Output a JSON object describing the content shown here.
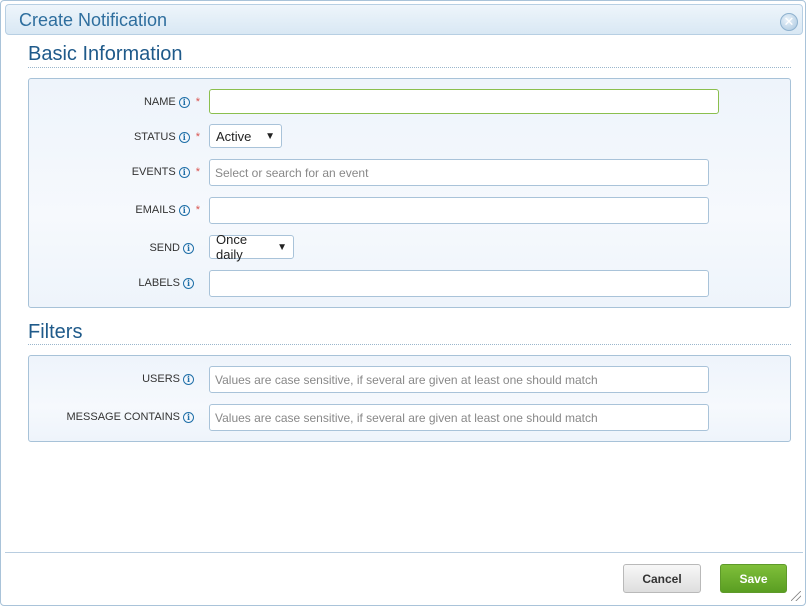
{
  "dialog": {
    "title": "Create Notification"
  },
  "basic": {
    "heading": "Basic Information",
    "name": {
      "label": "NAME",
      "value": ""
    },
    "status": {
      "label": "STATUS",
      "value": "Active"
    },
    "events": {
      "label": "EVENTS",
      "placeholder": "Select or search for an event"
    },
    "emails": {
      "label": "EMAILS",
      "value": ""
    },
    "send": {
      "label": "SEND",
      "value": "Once daily"
    },
    "labels": {
      "label": "LABELS",
      "value": ""
    }
  },
  "filters": {
    "heading": "Filters",
    "users": {
      "label": "USERS",
      "placeholder": "Values are case sensitive, if several are given at least one should match"
    },
    "message_contains": {
      "label": "MESSAGE CONTAINS",
      "placeholder": "Values are case sensitive, if several are given at least one should match"
    }
  },
  "footer": {
    "cancel_label": "Cancel",
    "save_label": "Save"
  },
  "icons": {
    "info": "info-icon",
    "close": "close-icon",
    "dropdown": "chevron-down-icon",
    "resize": "resize-grip-icon"
  },
  "colors": {
    "title_blue": "#2e6e9e",
    "save_green": "#6aad2e",
    "required_red": "#d9534f",
    "panel_bg": "#eef4fb"
  }
}
